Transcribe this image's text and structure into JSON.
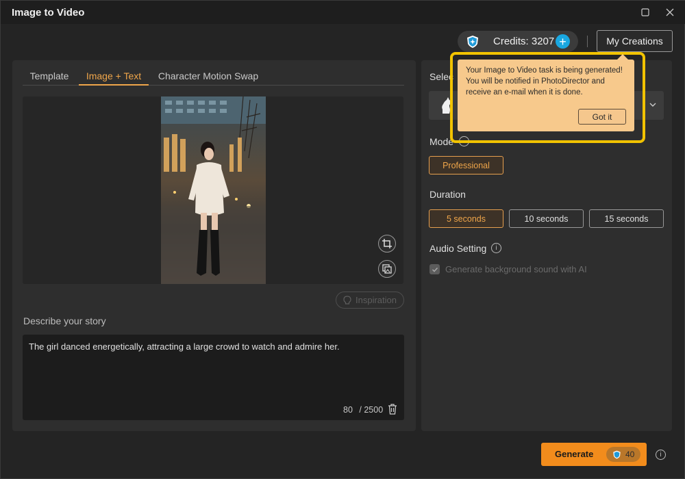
{
  "window": {
    "title": "Image to Video"
  },
  "header": {
    "credits_label": "Credits: 3207",
    "my_creations_label": "My Creations"
  },
  "tabs": [
    {
      "label": "Template",
      "active": false
    },
    {
      "label": "Image + Text",
      "active": true
    },
    {
      "label": "Character Motion Swap",
      "active": false
    }
  ],
  "image": {
    "description": "girl-in-white-sweater-photo",
    "tools": [
      "crop-icon",
      "replace-image-icon"
    ]
  },
  "inspiration_label": "Inspiration",
  "story": {
    "label": "Describe your story",
    "text": "The girl danced energetically, attracting a large crowd to watch and admire her.",
    "count": "80",
    "max": "/ 2500"
  },
  "settings": {
    "select_label": "Selec",
    "mode_label": "Mode",
    "mode_option": "Professional",
    "duration_label": "Duration",
    "durations": [
      {
        "label": "5 seconds",
        "selected": true
      },
      {
        "label": "10 seconds",
        "selected": false
      },
      {
        "label": "15 seconds",
        "selected": false
      }
    ],
    "audio_label": "Audio Setting",
    "audio_checkbox_label": "Generate background sound with AI"
  },
  "tooltip": {
    "text": "Your Image to Video task is being generated! You will be notified in PhotoDirector and receive an e-mail when it is done.",
    "button": "Got it"
  },
  "generate": {
    "label": "Generate",
    "cost": "40"
  },
  "colors": {
    "accent": "#f0a64a",
    "generate": "#f28c1c",
    "highlight": "#f2c300",
    "credit_plus": "#19a7e0"
  }
}
